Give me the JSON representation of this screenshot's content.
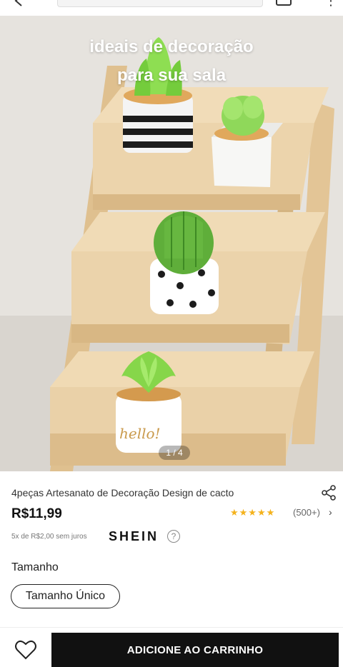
{
  "gallery": {
    "overlay_line1": "ideais de decoração",
    "overlay_line2": "para sua sala",
    "pager": "1 / 4"
  },
  "product": {
    "title": "4peças Artesanato de Decoração Design de cacto",
    "price": "R$11,99",
    "rating_stars": 4.5,
    "stars_display": "★★★★★",
    "rating_count": "(500+)",
    "installments": "5x de R$2,00 sem juros",
    "brand": "SHEIN",
    "help_icon": "?"
  },
  "size": {
    "label": "Tamanho",
    "options": [
      "Tamanho Único"
    ]
  },
  "actions": {
    "add_to_cart": "ADICIONE AO CARRINHO"
  },
  "icons": {
    "back": "back-arrow-icon",
    "bag": "shopping-bag-icon",
    "share": "share-icon",
    "wishlist": "heart-icon",
    "chevron": "chevron-right-icon"
  },
  "colors": {
    "stars": "#f4b21c",
    "button_bg": "#111111",
    "wood": "#e8cfa6",
    "succulent": "#7fd14a"
  }
}
